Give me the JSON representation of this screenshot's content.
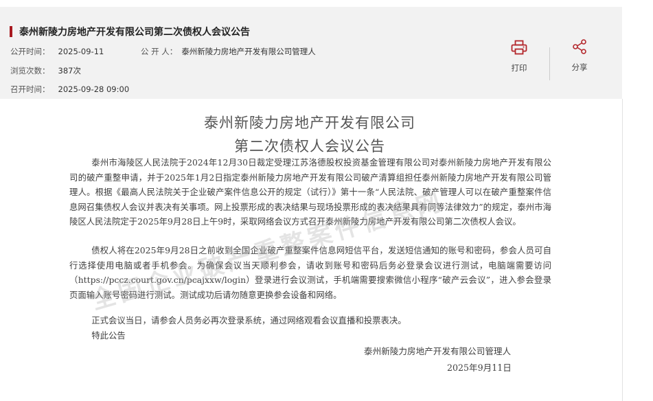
{
  "header": {
    "title": "泰州新陵力房地产开发有限公司第二次债权人会议公告",
    "publish_time_label": "公开时间：",
    "publish_time": "2025-09-11",
    "publisher_label": "公 开 人：",
    "publisher": "泰州新陵力房地产开发有限公司管理人",
    "views_label": "浏览次数：",
    "views": "387次",
    "meeting_time_label": "召开时间：",
    "meeting_time": "2025-09-28 09:00",
    "print_label": "打印",
    "share_label": "分享",
    "accent_color": "#a8191f"
  },
  "document": {
    "title_line1": "泰州新陵力房地产开发有限公司",
    "title_line2": "第二次债权人会议公告",
    "paragraphs": [
      "泰州市海陵区人民法院于2024年12月30日裁定受理江苏洛德股权投资基金管理有限公司对泰州新陵力房地产开发有限公司的破产重整申请，并于2025年1月2日指定泰州新陵力房地产开发有限公司破产清算组担任泰州新陵力房地产开发有限公司管理人。根据《最高人民法院关于企业破产案件信息公开的规定（试行）》第十一条“人民法院、破产管理人可以在破产重整案件信息网召集债权人会议并表决有关事项。网上投票形成的表决结果与现场投票形成的表决结果具有同等法律效力”的规定，泰州市海陵区人民法院定于2025年9月28日上午9时，采取网络会议方式召开泰州新陵力房地产开发有限公司第二次债权人会议。",
      "债权人将在2025年9月28日之前收到全国企业破产重整案件信息网短信平台，发送短信通知的账号和密码，参会人员可自行选择使用电脑或者手机参会。为确保会议当天顺利参会，请收到账号和密码后务必登录会议进行测试，电脑端需要访问（https://pccz.court.gov.cn/pcajxxw/login）登录进行会议测试，手机端需要搜索微信小程序“破产云会议”，进入参会登录页面输入账号密码进行测试。测试成功后请勿随意更换参会设备和网络。",
      "正式会议当日，请参会人员务必再次登录系统，通过网络观看会议直播和投票表决。",
      "特此公告"
    ],
    "signature": "泰州新陵力房地产开发有限公司管理人",
    "sign_date": "2025年9月11日"
  },
  "watermark": "全国企业破产重整案件信息网"
}
